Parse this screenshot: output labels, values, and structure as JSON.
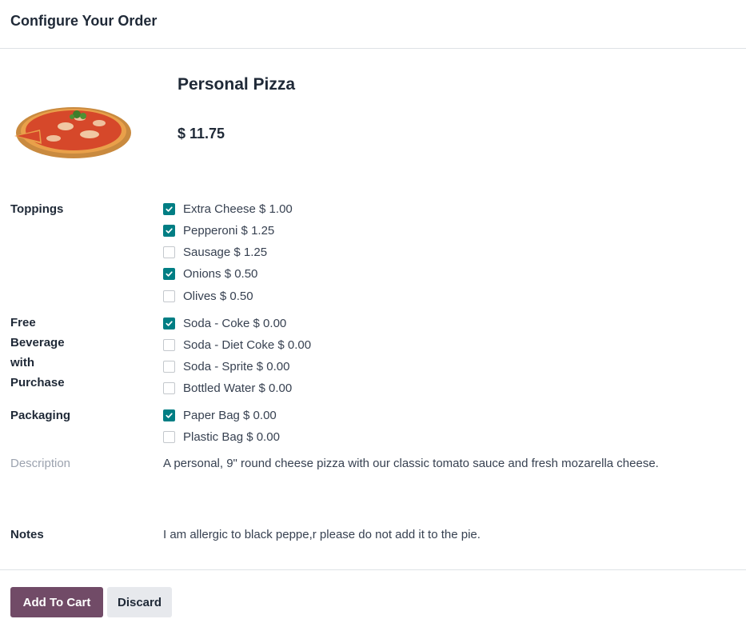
{
  "dialog": {
    "title": "Configure Your Order"
  },
  "product": {
    "name": "Personal Pizza",
    "price": "$ 11.75",
    "image_icon": "pizza-image"
  },
  "toppings": {
    "label": "Toppings",
    "options": [
      {
        "label": "Extra Cheese $ 1.00",
        "checked": true
      },
      {
        "label": "Pepperoni $ 1.25",
        "checked": true
      },
      {
        "label": "Sausage $ 1.25",
        "checked": false
      },
      {
        "label": "Onions $ 0.50",
        "checked": true
      },
      {
        "label": "Olives $ 0.50",
        "checked": false
      }
    ]
  },
  "beverage": {
    "label_lines": [
      "Free",
      "Beverage",
      "with",
      "Purchase"
    ],
    "options": [
      {
        "label": "Soda - Coke $ 0.00",
        "checked": true
      },
      {
        "label": "Soda - Diet Coke $ 0.00",
        "checked": false
      },
      {
        "label": "Soda - Sprite $ 0.00",
        "checked": false
      },
      {
        "label": "Bottled Water $ 0.00",
        "checked": false
      }
    ]
  },
  "packaging": {
    "label": "Packaging",
    "options": [
      {
        "label": "Paper Bag $ 0.00",
        "checked": true
      },
      {
        "label": "Plastic Bag $ 0.00",
        "checked": false
      }
    ]
  },
  "description": {
    "label": "Description",
    "text": "A personal, 9\" round cheese pizza with our classic tomato sauce and fresh mozarella cheese."
  },
  "notes": {
    "label": "Notes",
    "text": "I am allergic to black peppe,r please do not add it to the pie."
  },
  "footer": {
    "add_to_cart_label": "Add To Cart",
    "discard_label": "Discard"
  },
  "colors": {
    "primary": "#714b67",
    "checkbox_checked": "#017e84"
  }
}
